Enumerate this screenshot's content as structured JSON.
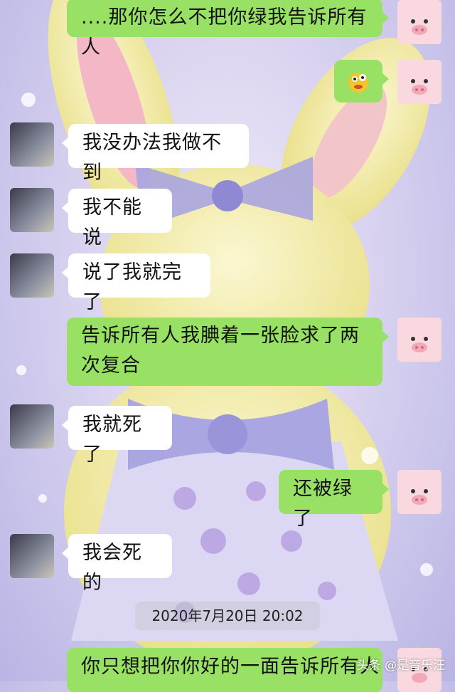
{
  "messages": [
    {
      "side": "out",
      "text": "....那你怎么不把你绿我告诉所有人"
    },
    {
      "side": "out",
      "sticker": "emoji-sticker"
    },
    {
      "side": "in",
      "text": "我没办法我做不到"
    },
    {
      "side": "in",
      "text": "我不能说"
    },
    {
      "side": "in",
      "text": "说了我就完了"
    },
    {
      "side": "out",
      "text": "告诉所有人我腆着一张脸求了两次复合"
    },
    {
      "side": "in",
      "text": "我就死了"
    },
    {
      "side": "out",
      "text": "还被绿了"
    },
    {
      "side": "in",
      "text": "我会死的"
    },
    {
      "side": "out",
      "text": "你只想把你你好的一面告诉所有人"
    }
  ],
  "timestamp": "2020年7月20日 20:02",
  "watermark": "头条 @是音乐汪",
  "colors": {
    "outgoing_bubble": "#98e165",
    "incoming_bubble": "#ffffff"
  }
}
